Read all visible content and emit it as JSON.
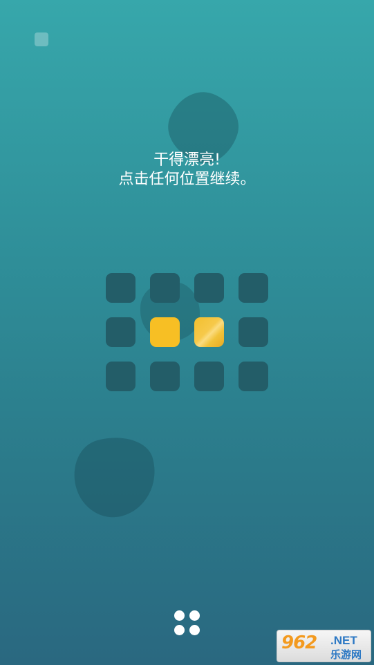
{
  "message": {
    "line1": "干得漂亮!",
    "line2": "点击任何位置继续。"
  },
  "puzzle": {
    "rows": 3,
    "cols": 4,
    "tiles": [
      [
        0,
        0,
        0,
        0
      ],
      [
        0,
        1,
        1,
        0
      ],
      [
        0,
        0,
        0,
        0
      ]
    ],
    "active_color": "#f7bf24",
    "inactive_color": "#235d68"
  },
  "menu_button": {
    "icon": "four-dots-icon"
  },
  "watermark": {
    "number": "962",
    "domain": ".NET",
    "site_name": "乐游网"
  },
  "colors": {
    "background_top": "#37a7ab",
    "background_bottom": "#2a6880",
    "text": "#ffffff"
  }
}
